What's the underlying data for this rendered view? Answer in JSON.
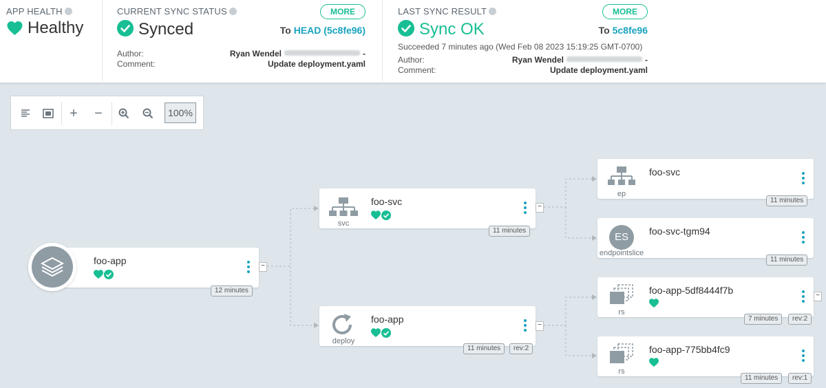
{
  "header": {
    "app_health": {
      "label": "APP HEALTH",
      "value": "Healthy"
    },
    "sync_status": {
      "label": "CURRENT SYNC STATUS",
      "more": "MORE",
      "value": "Synced",
      "to_prefix": "To",
      "to_value": "HEAD (5c8fe96)",
      "author_label": "Author:",
      "author": "Ryan Wendel",
      "author_suffix": "-",
      "comment_label": "Comment:",
      "comment": "Update deployment.yaml"
    },
    "sync_result": {
      "label": "LAST SYNC RESULT",
      "more": "MORE",
      "value": "Sync OK",
      "to_prefix": "To",
      "to_value": "5c8fe96",
      "succeeded": "Succeeded 7 minutes ago (Wed Feb 08 2023 15:19:25 GMT-0700)",
      "author_label": "Author:",
      "author": "Ryan Wendel",
      "author_suffix": "-",
      "comment_label": "Comment:",
      "comment": "Update deployment.yaml"
    }
  },
  "toolbar": {
    "zoom": "100%"
  },
  "nodes": {
    "app": {
      "name": "foo-app",
      "age": "12 minutes"
    },
    "svc": {
      "name": "foo-svc",
      "kind": "svc",
      "age": "11 minutes"
    },
    "deploy": {
      "name": "foo-app",
      "kind": "deploy",
      "age": "11 minutes",
      "rev": "rev:2"
    },
    "ep": {
      "name": "foo-svc",
      "kind": "ep",
      "age": "11 minutes"
    },
    "es": {
      "name": "foo-svc-tgm94",
      "kind": "endpointslice",
      "badge": "ES",
      "age": "11 minutes"
    },
    "rs1": {
      "name": "foo-app-5df8444f7b",
      "kind": "rs",
      "age": "7 minutes",
      "rev": "rev:2"
    },
    "rs2": {
      "name": "foo-app-775bb4fc9",
      "kind": "rs",
      "age": "11 minutes",
      "rev": "rev:1"
    }
  },
  "colors": {
    "accent": "#18be94",
    "link": "#18a3be",
    "background": "#dee6eb"
  }
}
